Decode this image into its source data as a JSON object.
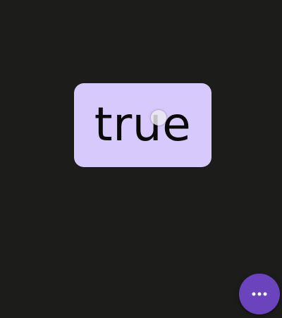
{
  "card": {
    "value": "true"
  },
  "fab": {
    "icon": "more-horizontal-icon"
  },
  "colors": {
    "background": "#1c1d1b",
    "card": "#d7c9fb",
    "fab": "#6a43bd",
    "text": "#0a0a0a"
  }
}
